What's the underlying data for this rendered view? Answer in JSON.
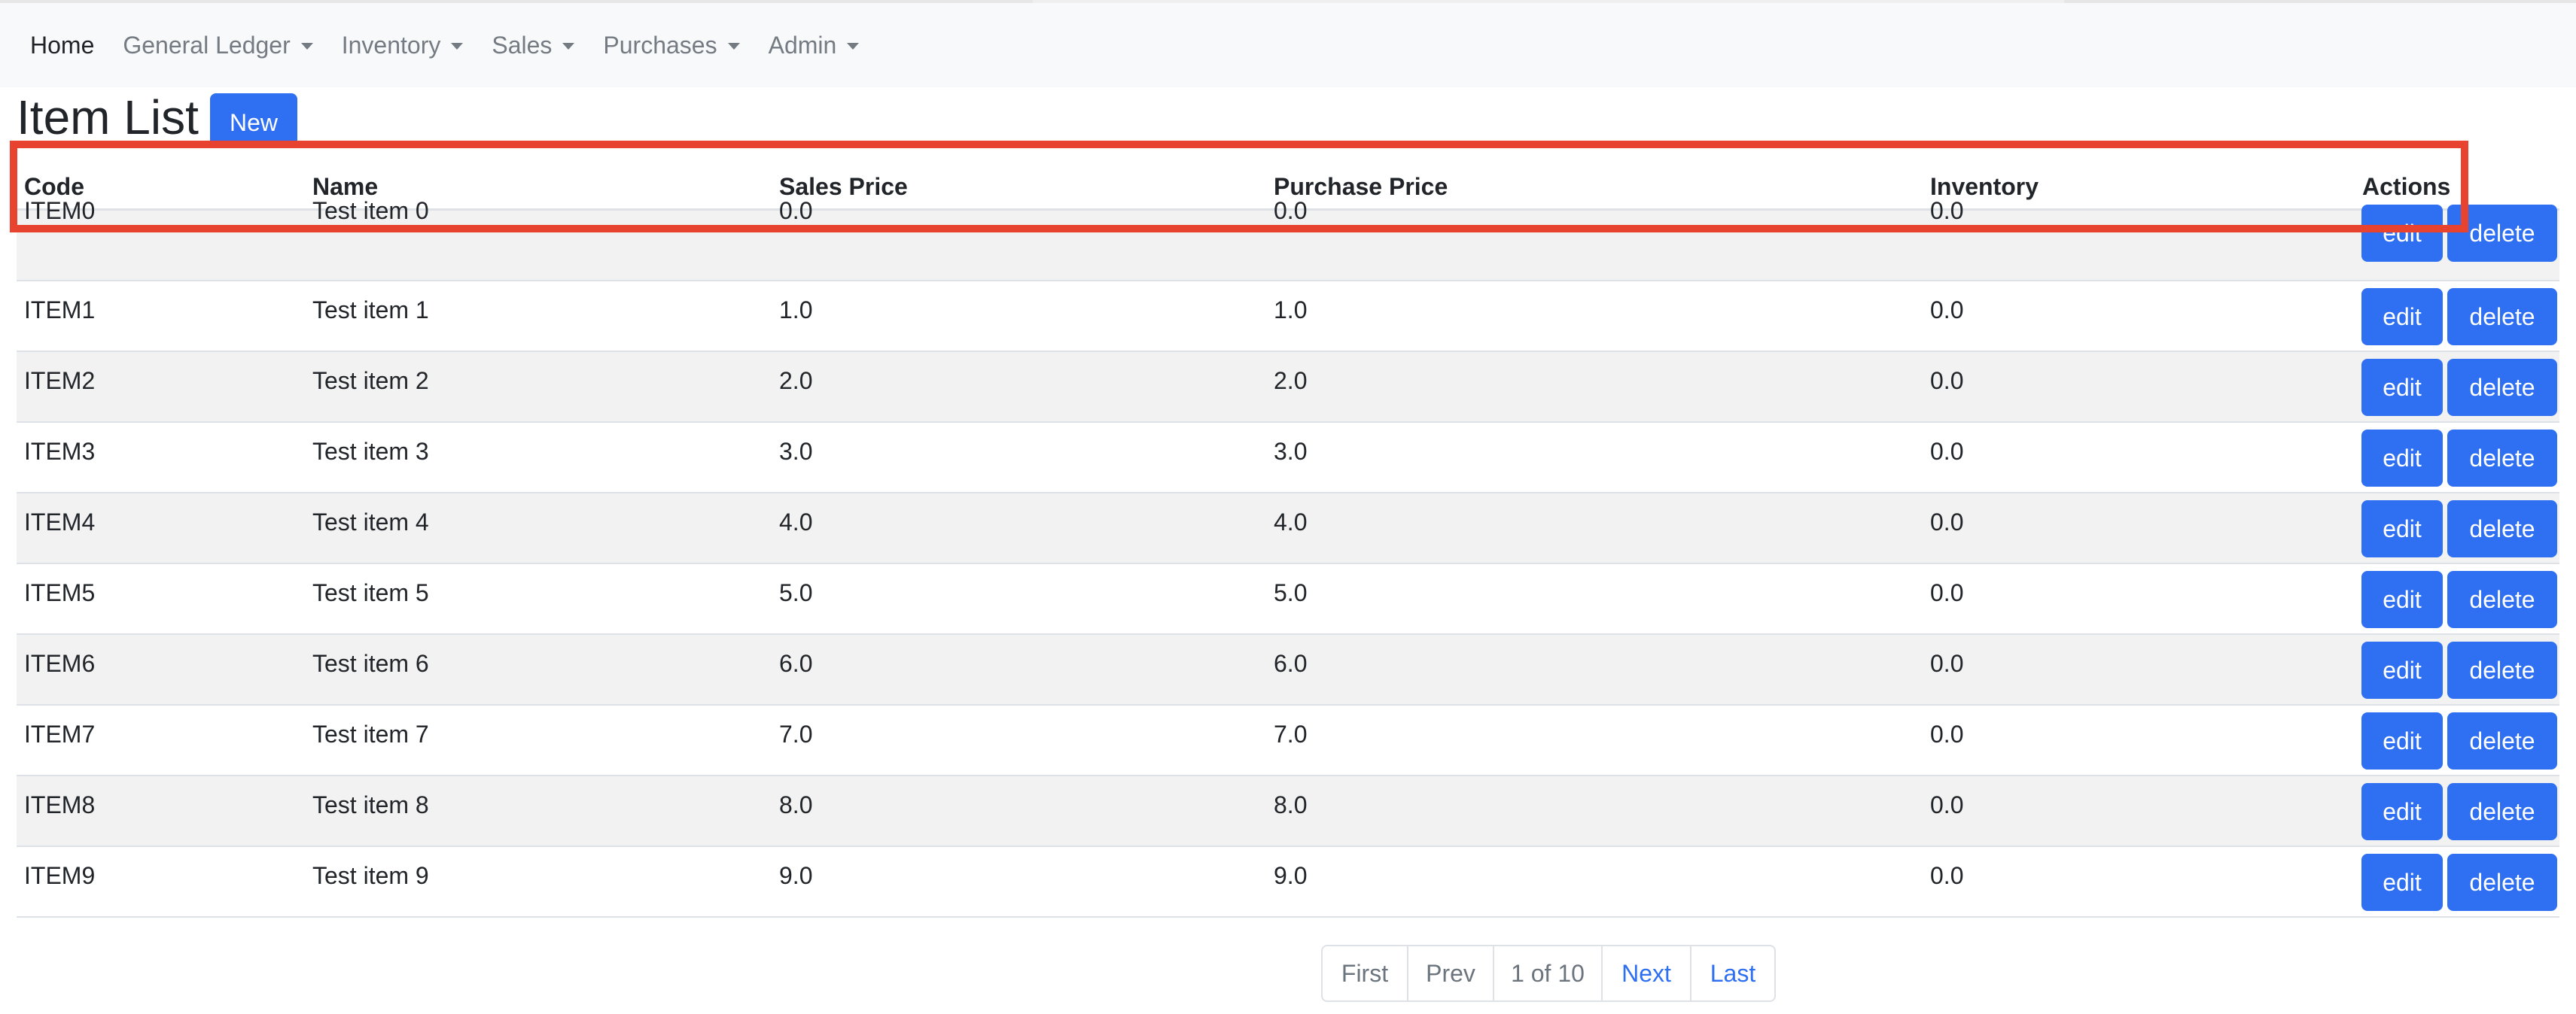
{
  "navbar": {
    "items": [
      {
        "label": "Home",
        "dropdown": false,
        "active": true
      },
      {
        "label": "General Ledger",
        "dropdown": true,
        "active": false
      },
      {
        "label": "Inventory",
        "dropdown": true,
        "active": false
      },
      {
        "label": "Sales",
        "dropdown": true,
        "active": false
      },
      {
        "label": "Purchases",
        "dropdown": true,
        "active": false
      },
      {
        "label": "Admin",
        "dropdown": true,
        "active": false
      }
    ]
  },
  "page": {
    "title": "Item List",
    "new_label": "New"
  },
  "table": {
    "headers": [
      "Code",
      "Name",
      "Sales Price",
      "Purchase Price",
      "Inventory",
      "Actions"
    ],
    "rows": [
      {
        "code": "ITEM0",
        "name": "Test item 0",
        "sales": "0.0",
        "purchase": "0.0",
        "inventory": "0.0"
      },
      {
        "code": "ITEM1",
        "name": "Test item 1",
        "sales": "1.0",
        "purchase": "1.0",
        "inventory": "0.0"
      },
      {
        "code": "ITEM2",
        "name": "Test item 2",
        "sales": "2.0",
        "purchase": "2.0",
        "inventory": "0.0"
      },
      {
        "code": "ITEM3",
        "name": "Test item 3",
        "sales": "3.0",
        "purchase": "3.0",
        "inventory": "0.0"
      },
      {
        "code": "ITEM4",
        "name": "Test item 4",
        "sales": "4.0",
        "purchase": "4.0",
        "inventory": "0.0"
      },
      {
        "code": "ITEM5",
        "name": "Test item 5",
        "sales": "5.0",
        "purchase": "5.0",
        "inventory": "0.0"
      },
      {
        "code": "ITEM6",
        "name": "Test item 6",
        "sales": "6.0",
        "purchase": "6.0",
        "inventory": "0.0"
      },
      {
        "code": "ITEM7",
        "name": "Test item 7",
        "sales": "7.0",
        "purchase": "7.0",
        "inventory": "0.0"
      },
      {
        "code": "ITEM8",
        "name": "Test item 8",
        "sales": "8.0",
        "purchase": "8.0",
        "inventory": "0.0"
      },
      {
        "code": "ITEM9",
        "name": "Test item 9",
        "sales": "9.0",
        "purchase": "9.0",
        "inventory": "0.0"
      }
    ],
    "edit_label": "edit",
    "delete_label": "delete"
  },
  "pagination": {
    "first": "First",
    "prev": "Prev",
    "current": "1 of 10",
    "next": "Next",
    "last": "Last"
  },
  "colors": {
    "primary": "#2f6ff2",
    "highlight": "#e8432f",
    "stripe": "#f2f2f2",
    "navbar_bg": "#f8f9fa"
  }
}
